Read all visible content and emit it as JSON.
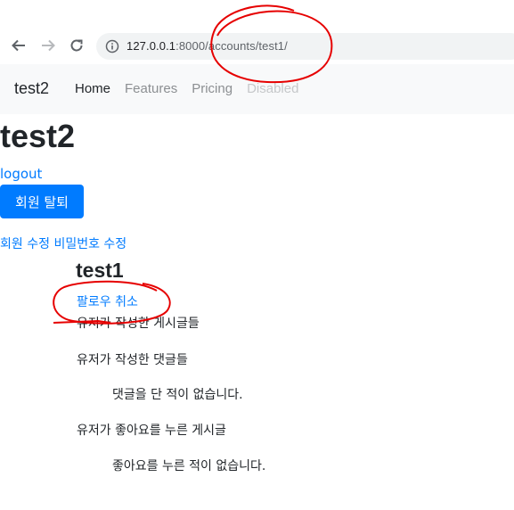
{
  "browser": {
    "url_host": "127.0.0.1",
    "url_port": ":8000",
    "url_path": "/accounts/test1/",
    "icons": [
      "back-arrow-icon",
      "forward-arrow-icon",
      "reload-icon",
      "info-icon"
    ]
  },
  "navbar": {
    "brand": "test2",
    "links": [
      {
        "label": "Home",
        "state": "active"
      },
      {
        "label": "Features",
        "state": "normal"
      },
      {
        "label": "Pricing",
        "state": "normal"
      },
      {
        "label": "Disabled",
        "state": "disabled"
      }
    ]
  },
  "header": {
    "username": "test2",
    "logout": "logout",
    "delete_account": "회원 탈퇴",
    "edit_profile": "회원 수정",
    "change_password": "비밀번호 수정"
  },
  "profile": {
    "name": "test1",
    "unfollow": "팔로우 취소",
    "posts_heading": "유저가 작성한 게시글들",
    "comments_heading": "유저가 작성한 댓글들",
    "comments_empty": "댓글을 단 적이 없습니다.",
    "likes_heading": "유저가 좋아요를 누른 게시글",
    "likes_empty": "좋아요를 누른 적이 없습니다."
  },
  "colors": {
    "link": "#007bff",
    "button": "#007bff",
    "navbar_bg": "#f8f9fa",
    "annotation": "#e60000"
  }
}
